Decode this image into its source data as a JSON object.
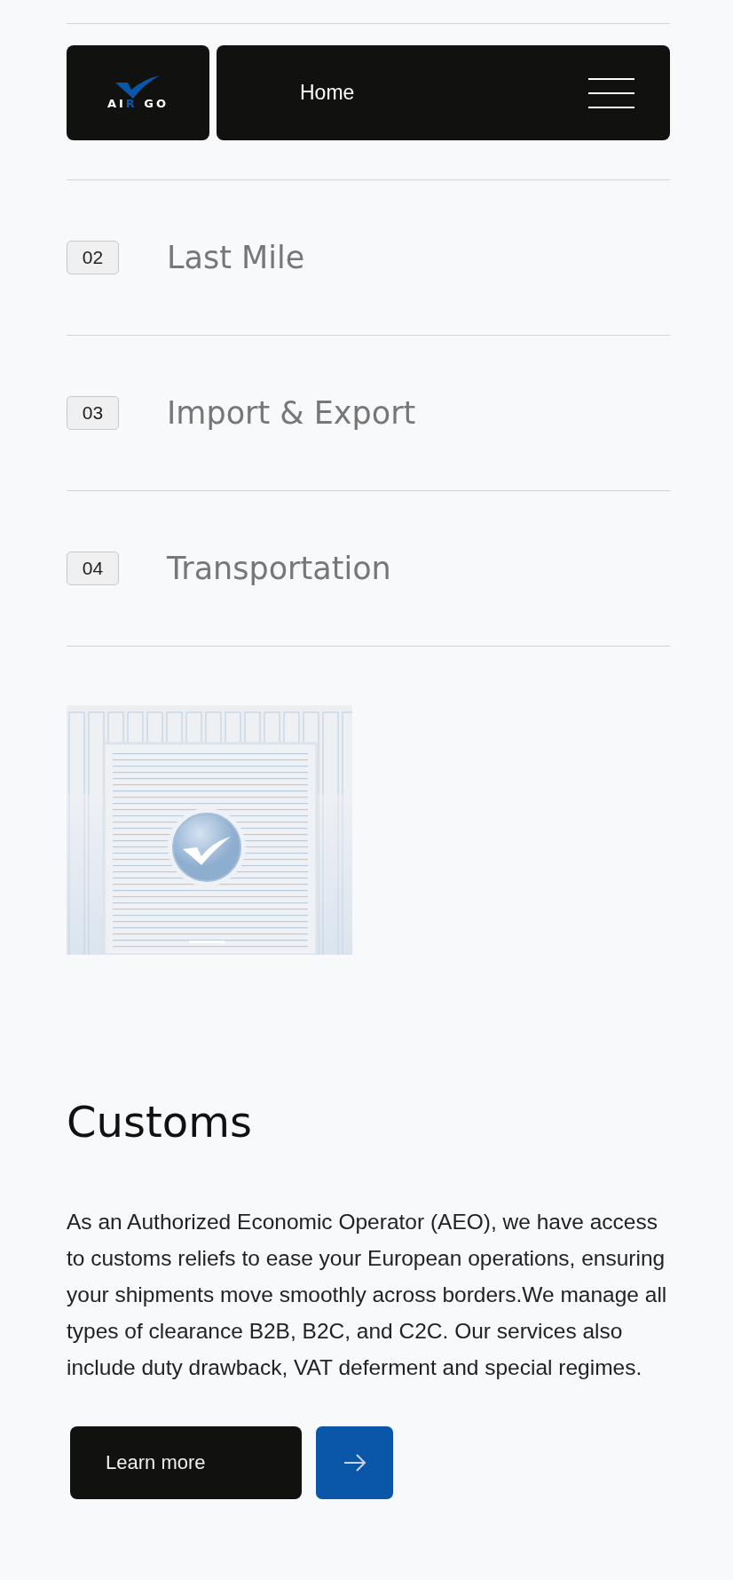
{
  "header": {
    "logo": [
      {
        "text": "AI",
        "accent": false
      },
      {
        "text": "R",
        "accent": true
      },
      {
        "text": " GO",
        "accent": false
      }
    ],
    "nav_label": "Home"
  },
  "services": [
    {
      "number": "02",
      "title": "Last Mile"
    },
    {
      "number": "03",
      "title": "Import & Export"
    },
    {
      "number": "04",
      "title": "Transportation"
    }
  ],
  "detail": {
    "title": "Customs",
    "text": "As an Authorized Economic Operator (AEO), we have access to customs reliefs to ease your European operations, ensuring your shipments move smoothly across borders.We manage all types of clearance B2B, B2C, and C2C. Our services also include duty drawback, VAT deferment and special regimes.",
    "button": "Learn more"
  }
}
